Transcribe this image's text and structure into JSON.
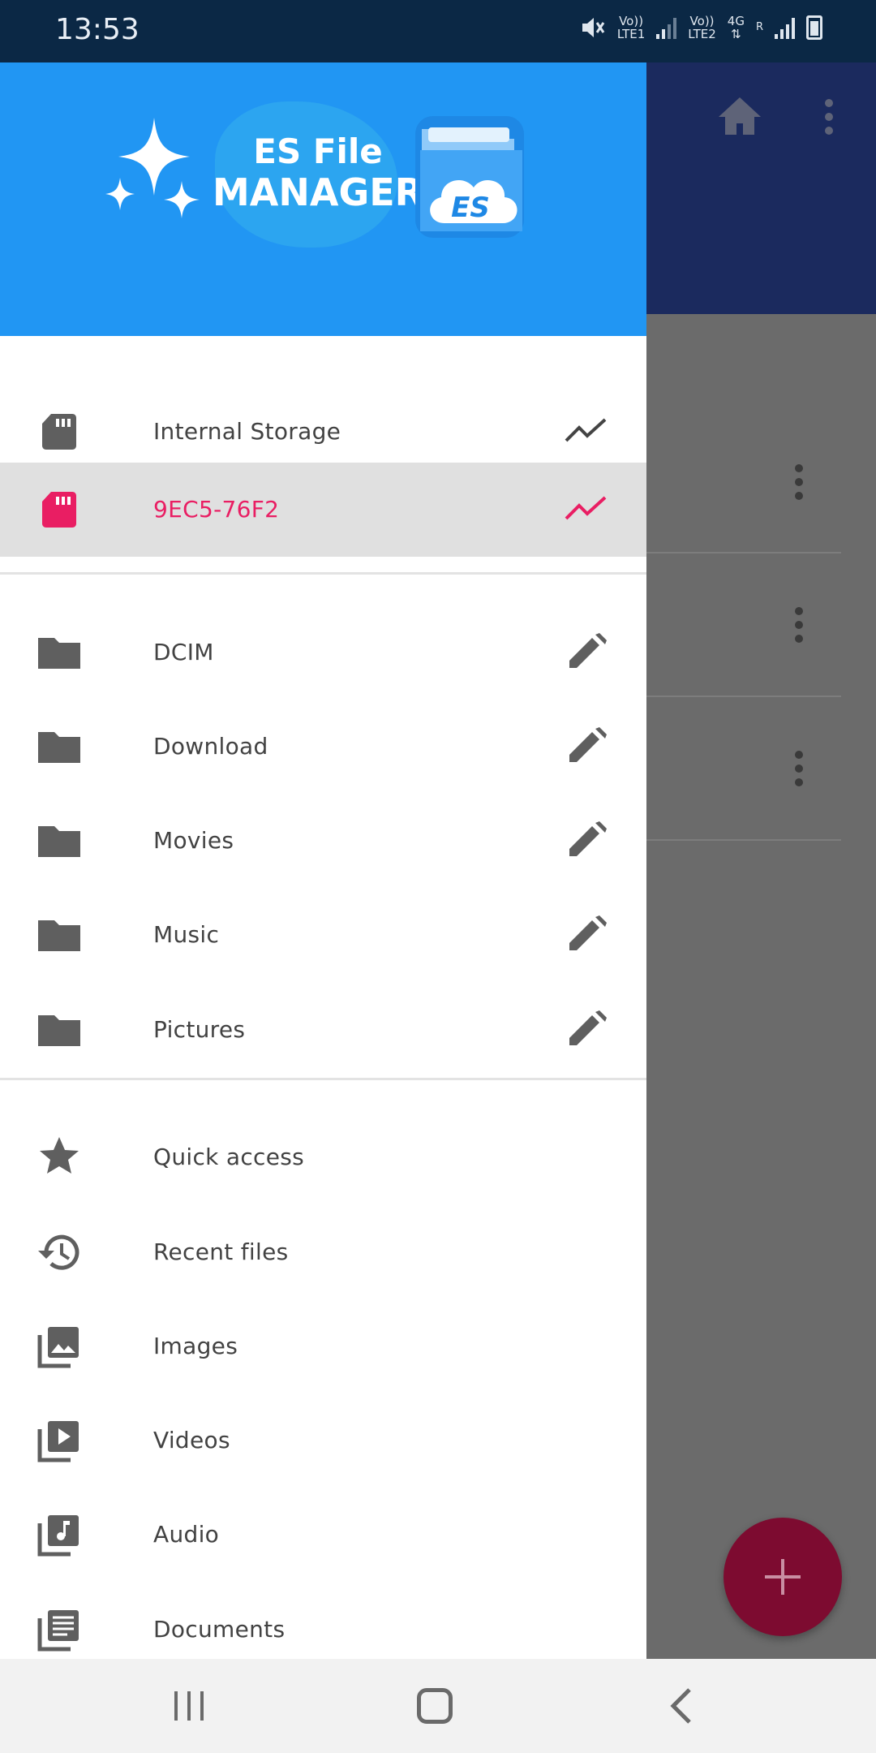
{
  "status_bar": {
    "time": "13:53",
    "sim1": {
      "top": "Vo))",
      "bottom": "LTE1"
    },
    "sim2": {
      "top": "Vo))",
      "bottom": "LTE2"
    },
    "network": "4G",
    "roaming": "R",
    "icons": [
      "mute-icon",
      "signal-icon",
      "battery-icon"
    ]
  },
  "drawer": {
    "logo": {
      "line1": "ES File",
      "line2": "MANAGER",
      "badge": "ES"
    },
    "storage": [
      {
        "label": "Internal Storage",
        "icon": "sd-card-icon",
        "action": "analyze-icon",
        "selected": false
      },
      {
        "label": "9EC5-76F2",
        "icon": "sd-card-icon",
        "action": "analyze-icon",
        "selected": true
      }
    ],
    "folders": [
      {
        "label": "DCIM",
        "icon": "folder-icon",
        "action": "edit-icon"
      },
      {
        "label": "Download",
        "icon": "folder-icon",
        "action": "edit-icon"
      },
      {
        "label": "Movies",
        "icon": "folder-icon",
        "action": "edit-icon"
      },
      {
        "label": "Music",
        "icon": "folder-icon",
        "action": "edit-icon"
      },
      {
        "label": "Pictures",
        "icon": "folder-icon",
        "action": "edit-icon"
      }
    ],
    "library": [
      {
        "label": "Quick access",
        "icon": "star-icon"
      },
      {
        "label": "Recent files",
        "icon": "history-icon"
      },
      {
        "label": "Images",
        "icon": "images-icon"
      },
      {
        "label": "Videos",
        "icon": "videos-icon"
      },
      {
        "label": "Audio",
        "icon": "audio-icon"
      },
      {
        "label": "Documents",
        "icon": "documents-icon"
      }
    ]
  },
  "colors": {
    "accent": "#e91e63",
    "header_blue": "#2196f3",
    "icon_gray": "#5f5f5f",
    "fab": "#7d0b30"
  }
}
